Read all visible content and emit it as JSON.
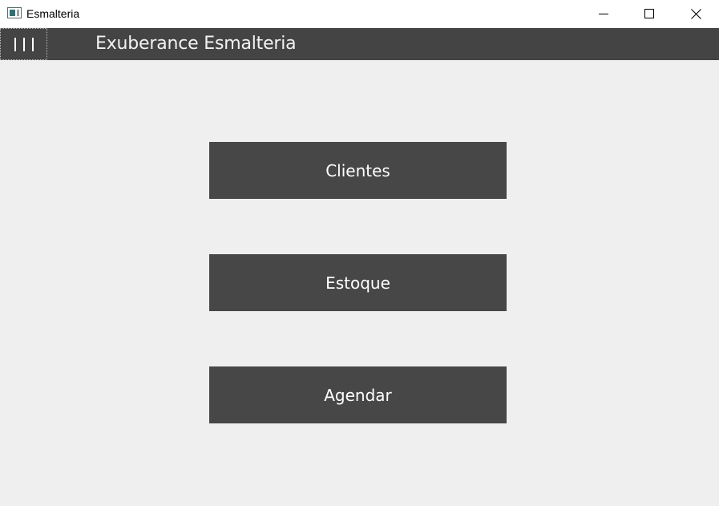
{
  "window": {
    "title": "Esmalteria",
    "controls": {
      "minimize_icon": "minimize-icon",
      "maximize_icon": "maximize-icon",
      "close_icon": "close-icon"
    }
  },
  "header": {
    "menu_icon": "hamburger-icon",
    "title": "Exuberance Esmalteria",
    "background_color": "#444444"
  },
  "main": {
    "buttons": [
      {
        "label": "Clientes"
      },
      {
        "label": "Estoque"
      },
      {
        "label": "Agendar"
      }
    ],
    "button_color": "#474747",
    "background_color": "#efefef"
  }
}
